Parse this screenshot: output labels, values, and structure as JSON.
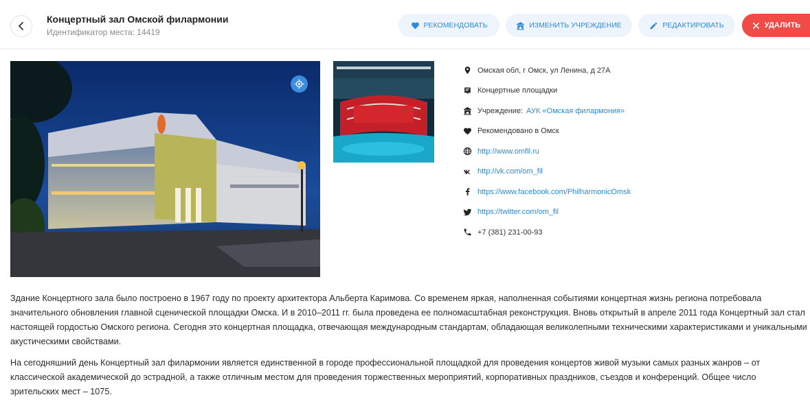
{
  "header": {
    "title": "Концертный зал Омской филармонии",
    "place_id": "Идентификатор места: 14419",
    "actions": {
      "recommend": "РЕКОМЕНДОВАТЬ",
      "change_institution": "ИЗМЕНИТЬ УЧРЕЖДЕНИЕ",
      "edit": "РЕДАКТИРОВАТЬ",
      "delete": "УДАЛИТЬ"
    }
  },
  "info": {
    "address": "Омская обл, г Омск, ул Ленина, д 27А",
    "category": "Концертные площадки",
    "institution_label": "Учреждение:",
    "institution_link": "АУК «Омская филармония»",
    "recommended": "Рекомендовано в Омск",
    "website": "http://www.omfil.ru",
    "vk": "http://vk.com/om_fil",
    "facebook": "https://www.facebook.com/PhilharmonicOmsk",
    "twitter": "https://twitter.com/om_fil",
    "phone": "+7 (381) 231-00-93"
  },
  "description": {
    "p1": "Здание Концертного зала было построено в 1967 году по проекту архитектора Альберта Каримова. Со временем яркая, наполненная событиями концертная жизнь региона потребовала значительного обновления главной сценической площадки Омска. И в 2010–2011 гг. была проведена ее полномасштабная реконструкция. Вновь открытый в апреле 2011 года Концертный зал стал настоящей гордостью Омского региона. Сегодня это концертная площадка, отвечающая международным стандартам, обладающая великолепными техническими характеристиками и уникальными акустическими свойствами.",
    "p2": "На сегодняшний день Концертный зал филармонии является единственной в городе профессиональной площадкой для проведения концертов живой музыки самых разных жанров – от классической академической до эстрадной, а также отличным местом для проведения торжественных мероприятий, корпоративных праздников, съездов и конференций. Общее число зрительских мест – 1075."
  },
  "colors": {
    "accent": "#2d8bd8",
    "button_bg": "#eef4fb",
    "danger": "#f14b47"
  }
}
